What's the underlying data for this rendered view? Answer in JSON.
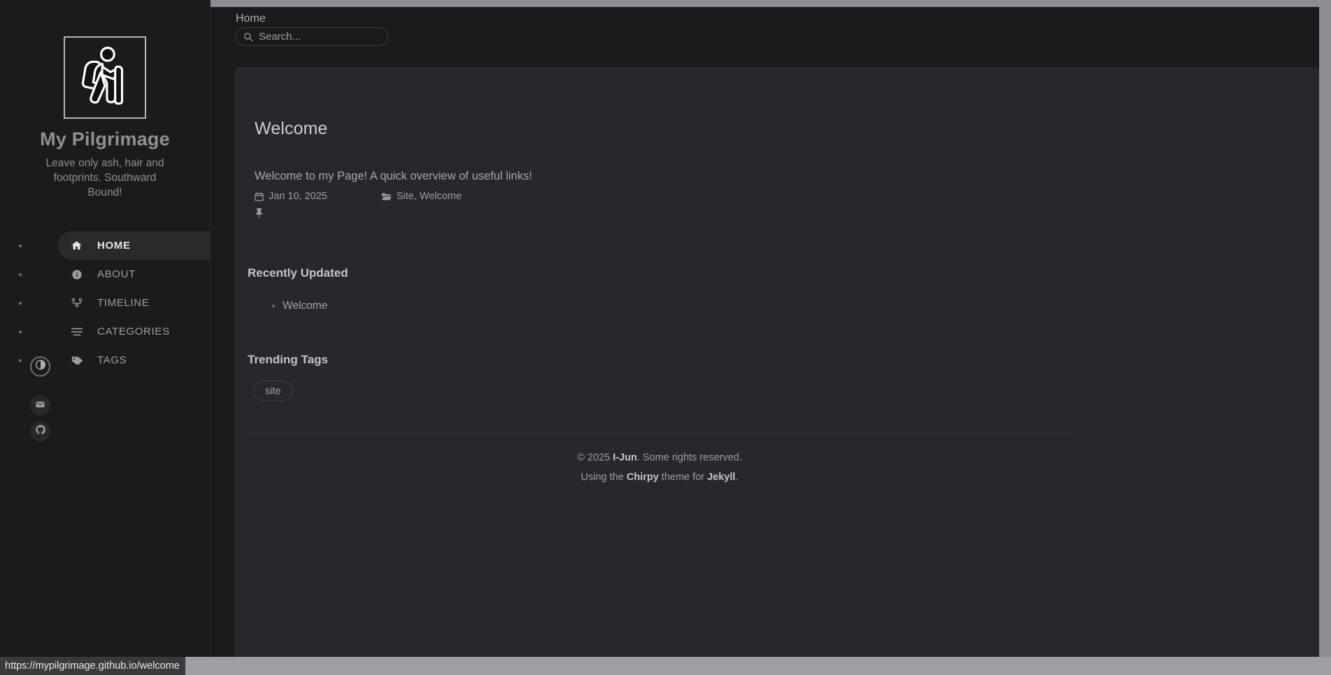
{
  "browser": {
    "status_url": "https://mypilgrimage.github.io/welcome"
  },
  "sidebar": {
    "logo_icon": "hiker-with-backpack-icon",
    "title": "My Pilgrimage",
    "subtitle": "Leave only ash, hair and footprints. Southward Bound!",
    "nav": [
      {
        "label": "HOME",
        "icon": "home-icon",
        "active": true
      },
      {
        "label": "ABOUT",
        "icon": "info-circle-icon",
        "active": false
      },
      {
        "label": "TIMELINE",
        "icon": "timeline-icon",
        "active": false
      },
      {
        "label": "CATEGORIES",
        "icon": "stream-list-icon",
        "active": false
      },
      {
        "label": "TAGS",
        "icon": "tags-icon",
        "active": false
      }
    ],
    "mode_toggle_icon": "contrast-half-circle-icon",
    "contacts": [
      {
        "name": "email",
        "icon": "envelope-icon"
      },
      {
        "name": "github",
        "icon": "github-icon"
      }
    ]
  },
  "topbar": {
    "breadcrumb": "Home",
    "search_placeholder": "Search...",
    "search_value": "",
    "search_icon": "search-icon"
  },
  "post": {
    "title": "Welcome",
    "description": "Welcome to my Page! A quick overview of useful links!",
    "date_icon": "calendar-icon",
    "date": "Jan 10, 2025",
    "category_icon": "folder-open-icon",
    "categories": "Site, Welcome",
    "pin_icon": "pin-icon"
  },
  "recently_updated": {
    "title": "Recently Updated",
    "items": [
      {
        "label": "Welcome"
      }
    ]
  },
  "trending_tags": {
    "title": "Trending Tags",
    "tags": [
      {
        "label": "site"
      }
    ]
  },
  "footer": {
    "copyright_prefix": "© 2025 ",
    "author": "I-Jun",
    "copyright_suffix": ". Some rights reserved.",
    "theme_prefix": "Using the ",
    "theme_name": "Chirpy",
    "theme_mid": " theme for ",
    "engine_name": "Jekyll",
    "theme_suffix": "."
  },
  "colors": {
    "page_bg": "#1b1b1e",
    "panel_bg": "#26282c",
    "accent_text": "#c9ccd0",
    "muted_text": "#9a9da1",
    "scrollbar": "#8b8d93"
  }
}
